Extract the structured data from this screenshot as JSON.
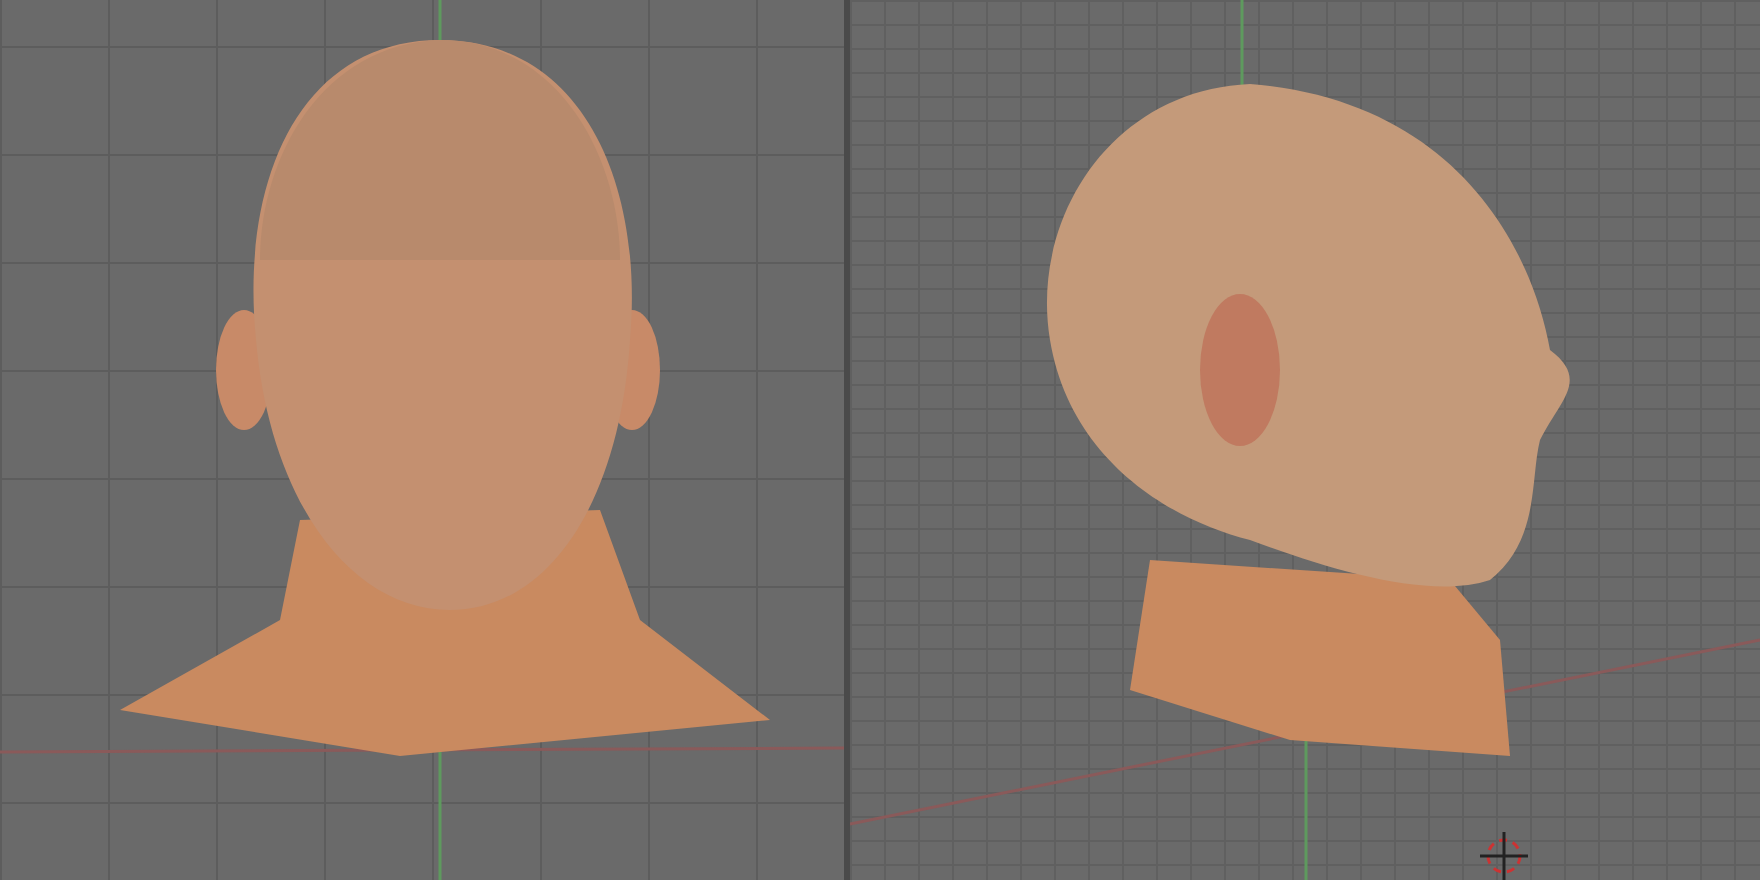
{
  "viewports": [
    {
      "kind": "front"
    },
    {
      "kind": "side"
    }
  ]
}
